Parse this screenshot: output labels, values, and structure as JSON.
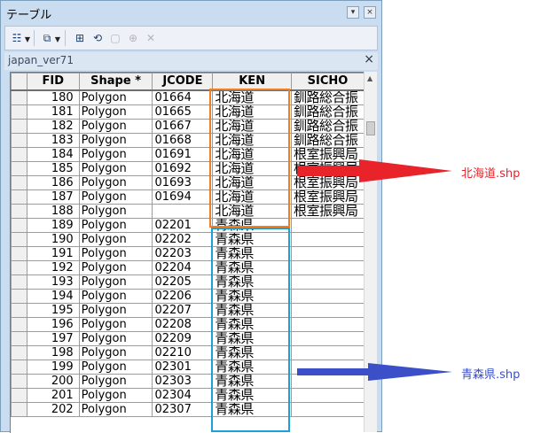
{
  "window": {
    "title": "テーブル",
    "pin_glyph": "▾",
    "close_glyph": "×"
  },
  "toolbar": {
    "icons": [
      "table-options-icon",
      "related-tables-icon",
      "select-by-attributes-icon",
      "switch-selection-icon",
      "clear-selection-icon",
      "zoom-to-selected-icon",
      "delete-selected-icon"
    ],
    "glyphs": [
      "☷",
      "⧉",
      "⊞",
      "⟲",
      "▢",
      "⊕",
      "✕"
    ]
  },
  "tab": {
    "name": "japan_ver71",
    "close_glyph": "×"
  },
  "table": {
    "columns": [
      "",
      "FID",
      "Shape *",
      "JCODE",
      "KEN",
      "SICHO"
    ],
    "rows": [
      [
        "180",
        "Polygon",
        "01664",
        "北海道",
        "釧路総合振"
      ],
      [
        "181",
        "Polygon",
        "01665",
        "北海道",
        "釧路総合振"
      ],
      [
        "182",
        "Polygon",
        "01667",
        "北海道",
        "釧路総合振"
      ],
      [
        "183",
        "Polygon",
        "01668",
        "北海道",
        "釧路総合振"
      ],
      [
        "184",
        "Polygon",
        "01691",
        "北海道",
        "根室振興局"
      ],
      [
        "185",
        "Polygon",
        "01692",
        "北海道",
        "根室振興局"
      ],
      [
        "186",
        "Polygon",
        "01693",
        "北海道",
        "根室振興局"
      ],
      [
        "187",
        "Polygon",
        "01694",
        "北海道",
        "根室振興局"
      ],
      [
        "188",
        "Polygon",
        "",
        "北海道",
        "根室振興局"
      ],
      [
        "189",
        "Polygon",
        "02201",
        "青森県",
        ""
      ],
      [
        "190",
        "Polygon",
        "02202",
        "青森県",
        ""
      ],
      [
        "191",
        "Polygon",
        "02203",
        "青森県",
        ""
      ],
      [
        "192",
        "Polygon",
        "02204",
        "青森県",
        ""
      ],
      [
        "193",
        "Polygon",
        "02205",
        "青森県",
        ""
      ],
      [
        "194",
        "Polygon",
        "02206",
        "青森県",
        ""
      ],
      [
        "195",
        "Polygon",
        "02207",
        "青森県",
        ""
      ],
      [
        "196",
        "Polygon",
        "02208",
        "青森県",
        ""
      ],
      [
        "197",
        "Polygon",
        "02209",
        "青森県",
        ""
      ],
      [
        "198",
        "Polygon",
        "02210",
        "青森県",
        ""
      ],
      [
        "199",
        "Polygon",
        "02301",
        "青森県",
        ""
      ],
      [
        "200",
        "Polygon",
        "02303",
        "青森県",
        ""
      ],
      [
        "201",
        "Polygon",
        "02304",
        "青森県",
        ""
      ],
      [
        "202",
        "Polygon",
        "02307",
        "青森県",
        ""
      ]
    ]
  },
  "annotations": {
    "hokkaido": {
      "label": "北海道.shp",
      "color": "#e8232a",
      "box_color": "#f07f21"
    },
    "aomori": {
      "label": "青森県.shp",
      "color": "#3a4fc8",
      "box_color": "#1e9fd8"
    }
  },
  "colors": {
    "window_bg": "#c9dcf0",
    "header_bg": "#f0f0f0"
  }
}
